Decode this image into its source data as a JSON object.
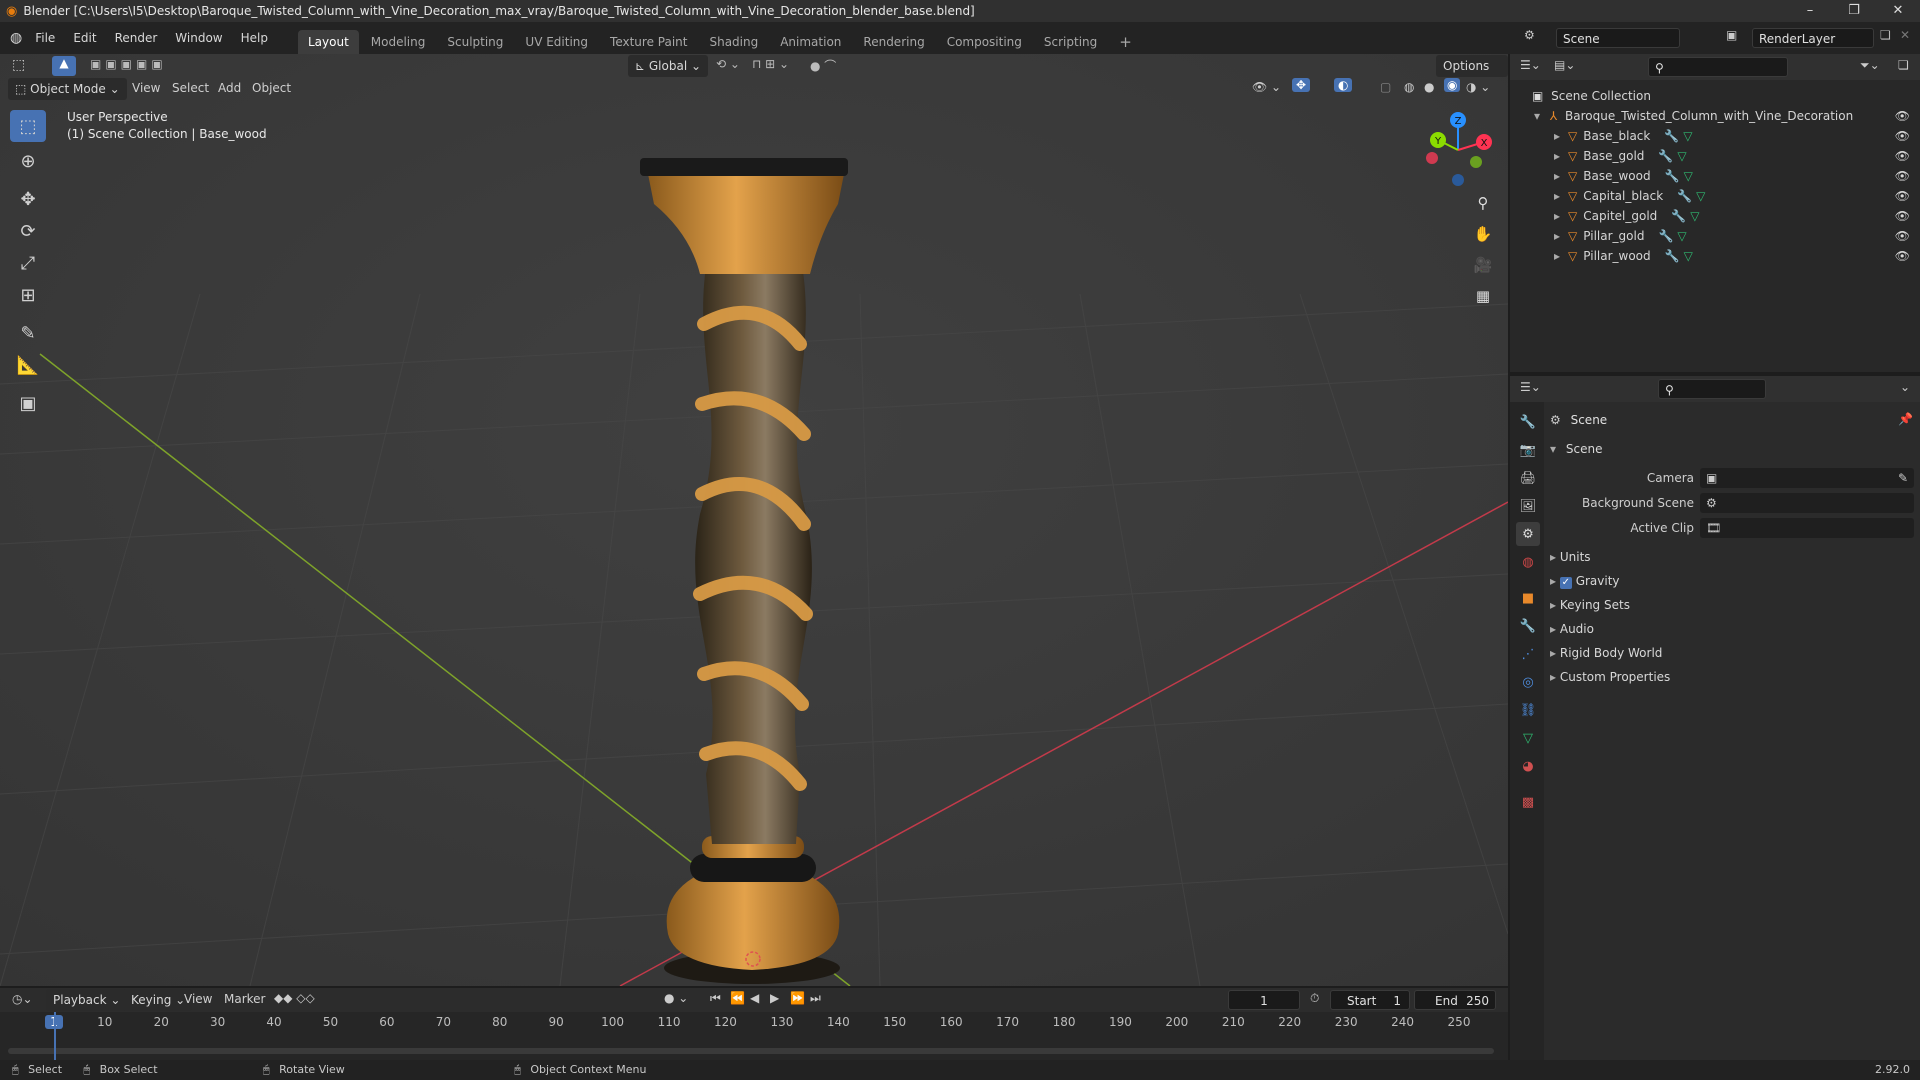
{
  "window": {
    "title": "Blender [C:\\Users\\I5\\Desktop\\Baroque_Twisted_Column_with_Vine_Decoration_max_vray/Baroque_Twisted_Column_with_Vine_Decoration_blender_base.blend]",
    "minimize": "–",
    "maximize": "❐",
    "close": "✕"
  },
  "menu": [
    "File",
    "Edit",
    "Render",
    "Window",
    "Help"
  ],
  "workspaces": [
    {
      "label": "Layout",
      "active": true
    },
    {
      "label": "Modeling"
    },
    {
      "label": "Sculpting"
    },
    {
      "label": "UV Editing"
    },
    {
      "label": "Texture Paint"
    },
    {
      "label": "Shading"
    },
    {
      "label": "Animation"
    },
    {
      "label": "Rendering"
    },
    {
      "label": "Compositing"
    },
    {
      "label": "Scripting"
    }
  ],
  "scene_field": "Scene",
  "renderlayer_field": "RenderLayer",
  "viewport": {
    "mode": "Object Mode",
    "menus": [
      "View",
      "Select",
      "Add",
      "Object"
    ],
    "transform_orientation": "Global",
    "options_label": "Options",
    "overlay_title": "User Perspective",
    "overlay_subtitle": "(1) Scene Collection | Base_wood",
    "gizmo_axes": {
      "x": "X",
      "y": "Y",
      "z": "Z"
    }
  },
  "outliner": {
    "root": "Scene Collection",
    "collection": "Baroque_Twisted_Column_with_Vine_Decoration",
    "objects": [
      "Base_black",
      "Base_gold",
      "Base_wood",
      "Capital_black",
      "Capitel_gold",
      "Pillar_gold",
      "Pillar_wood"
    ]
  },
  "properties": {
    "context": "Scene",
    "section": "Scene",
    "fields": [
      {
        "label": "Camera"
      },
      {
        "label": "Background Scene"
      },
      {
        "label": "Active Clip"
      }
    ],
    "panels": [
      "Units",
      "Gravity",
      "Keying Sets",
      "Audio",
      "Rigid Body World",
      "Custom Properties"
    ]
  },
  "timeline": {
    "menus": [
      "Playback",
      "Keying",
      "View",
      "Marker"
    ],
    "current_frame": "1",
    "start_label": "Start",
    "start": "1",
    "end_label": "End",
    "end": "250",
    "ruler": [
      "1",
      "10",
      "20",
      "30",
      "40",
      "50",
      "60",
      "70",
      "80",
      "90",
      "100",
      "110",
      "120",
      "130",
      "140",
      "150",
      "160",
      "170",
      "180",
      "190",
      "200",
      "210",
      "220",
      "230",
      "240",
      "250"
    ]
  },
  "status": {
    "select": "Select",
    "box_select": "Box Select",
    "rotate": "Rotate View",
    "context_menu": "Object Context Menu",
    "version": "2.92.0"
  },
  "colors": {
    "accent": "#4772b3",
    "x_axis": "#ff3352",
    "y_axis": "#8bdc00",
    "z_axis": "#2890ff",
    "object_orange": "#e8892b"
  }
}
